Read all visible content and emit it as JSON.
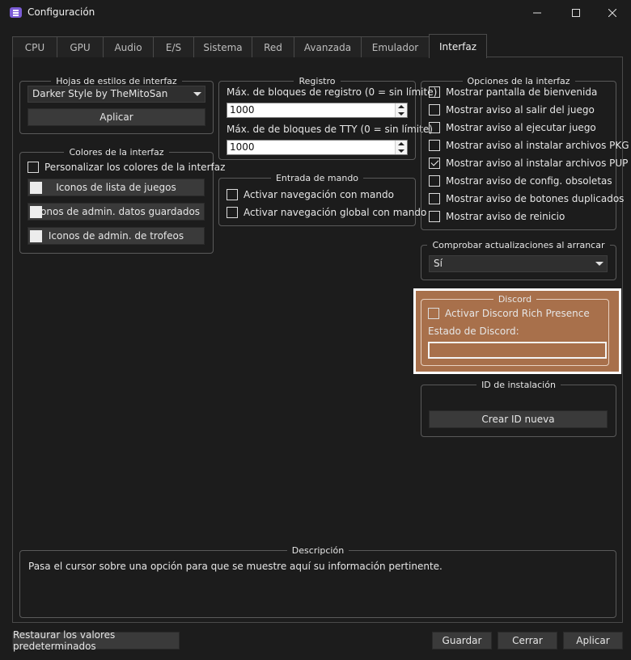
{
  "window": {
    "title": "Configuración",
    "minimize_icon": "minimize-icon",
    "maximize_icon": "maximize-icon",
    "close_icon": "close-icon"
  },
  "tabs": [
    {
      "label": "CPU",
      "active": false
    },
    {
      "label": "GPU",
      "active": false
    },
    {
      "label": "Audio",
      "active": false
    },
    {
      "label": "E/S",
      "active": false
    },
    {
      "label": "Sistema",
      "active": false
    },
    {
      "label": "Red",
      "active": false
    },
    {
      "label": "Avanzada",
      "active": false
    },
    {
      "label": "Emulador",
      "active": false
    },
    {
      "label": "Interfaz",
      "active": true
    }
  ],
  "stylesheets": {
    "title": "Hojas de estilos de interfaz",
    "selected": "Darker Style by TheMitoSan",
    "apply_label": "Aplicar"
  },
  "colors": {
    "title": "Colores de la interfaz",
    "customize_label": "Personalizar los colores de la interfaz",
    "customize_checked": false,
    "buttons": [
      {
        "label": "Iconos de lista de juegos",
        "swatch": "#ececec"
      },
      {
        "label": "Iconos de admin. datos guardados",
        "swatch": "#ececec"
      },
      {
        "label": "Iconos de admin. de trofeos",
        "swatch": "#ececec"
      }
    ]
  },
  "log": {
    "title": "Registro",
    "max_blocks_label": "Máx. de bloques de registro (0 = sin límite)",
    "max_blocks_value": "1000",
    "max_tty_label": "Máx. de de bloques de TTY (0 = sin límite)",
    "max_tty_value": "1000"
  },
  "pad": {
    "title": "Entrada de mando",
    "options": [
      {
        "label": "Activar navegación con mando",
        "checked": false
      },
      {
        "label": "Activar navegación global con mando",
        "checked": false
      }
    ]
  },
  "ui_options": {
    "title": "Opciones de la interfaz",
    "options": [
      {
        "label": "Mostrar pantalla de bienvenida",
        "checked": false
      },
      {
        "label": "Mostrar aviso al salir del juego",
        "checked": false
      },
      {
        "label": "Mostrar aviso al ejecutar juego",
        "checked": false
      },
      {
        "label": "Mostrar aviso al instalar archivos PKG",
        "checked": false
      },
      {
        "label": "Mostrar aviso al instalar archivos PUP",
        "checked": true
      },
      {
        "label": "Mostrar aviso de config. obsoletas",
        "checked": false
      },
      {
        "label": "Mostrar aviso de botones duplicados",
        "checked": false
      },
      {
        "label": "Mostrar aviso de reinicio",
        "checked": false
      }
    ]
  },
  "updates": {
    "title": "Comprobar actualizaciones al arrancar",
    "selected": "Sí"
  },
  "discord": {
    "title": "Discord",
    "rich_presence_label": "Activar Discord Rich Presence",
    "rich_presence_checked": false,
    "status_label": "Estado de Discord:",
    "status_value": "",
    "highlight_color": "#a8704b"
  },
  "install_id": {
    "title": "ID de instalación",
    "button_label": "Crear ID nueva"
  },
  "description": {
    "title": "Descripción",
    "text": "Pasa el cursor sobre una opción para que se muestre aquí su información pertinente."
  },
  "footer": {
    "restore_label": "Restaurar los valores predeterminados",
    "save_label": "Guardar",
    "close_label": "Cerrar",
    "apply_label": "Aplicar"
  }
}
